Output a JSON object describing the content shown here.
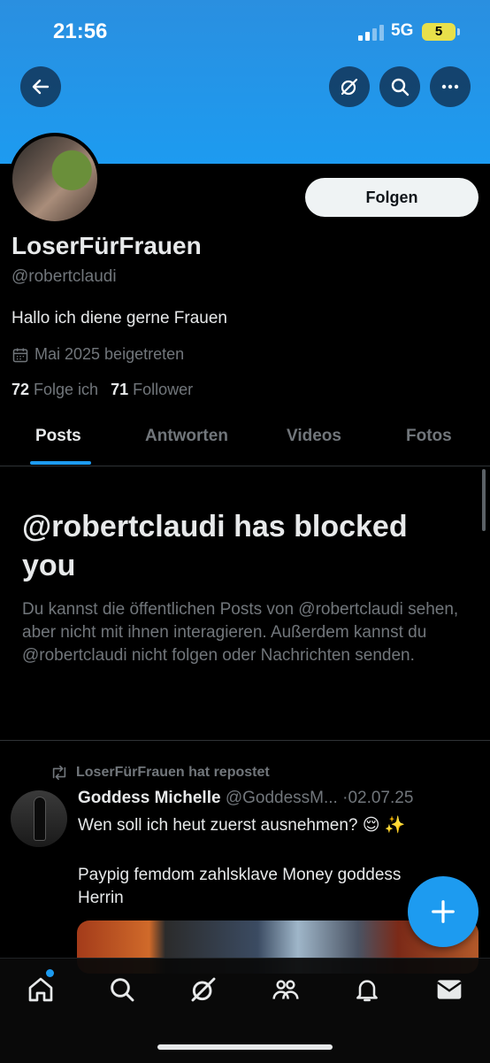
{
  "status_bar": {
    "time": "21:56",
    "network": "5G",
    "battery": "5"
  },
  "profile": {
    "display_name": "LoserFürFrauen",
    "handle": "@robertclaudi",
    "bio": "Hallo ich diene gerne Frauen",
    "joined": "Mai 2025 beigetreten",
    "following_count": "72",
    "following_label": "Folge ich",
    "followers_count": "71",
    "followers_label": "Follower",
    "follow_button": "Folgen"
  },
  "tabs": [
    {
      "label": "Posts",
      "active": true
    },
    {
      "label": "Antworten",
      "active": false
    },
    {
      "label": "Videos",
      "active": false
    },
    {
      "label": "Fotos",
      "active": false
    }
  ],
  "blocked": {
    "title": "@robertclaudi has blocked you",
    "text": "Du kannst die öffentlichen Posts von @robertclaudi sehen, aber nicht mit ihnen interagieren. Außerdem kannst du @robertclaudi nicht folgen oder Nachrichten senden."
  },
  "post": {
    "repost_label": "LoserFürFrauen hat repostet",
    "author_name": "Goddess Michelle",
    "author_handle": "@GoddessM...",
    "separator": "·",
    "date": "02.07.25",
    "text_line1": "Wen soll ich heut zuerst ausnehmen? 😌 ✨",
    "text_line2": "Paypig femdom zahlsklave Money goddess Herrin"
  },
  "icons": {
    "back": "arrow-left-icon",
    "grok": "grok-icon",
    "search": "search-icon",
    "more": "more-icon",
    "calendar": "calendar-icon",
    "repost": "repost-icon",
    "compose": "plus-icon",
    "nav": [
      "home-icon",
      "search-icon",
      "grok-icon",
      "communities-icon",
      "bell-icon",
      "mail-icon"
    ]
  },
  "colors": {
    "accent": "#1d9bf0",
    "banner": "#1d9bf0",
    "muted": "#71767b",
    "text": "#e7e9ea"
  }
}
